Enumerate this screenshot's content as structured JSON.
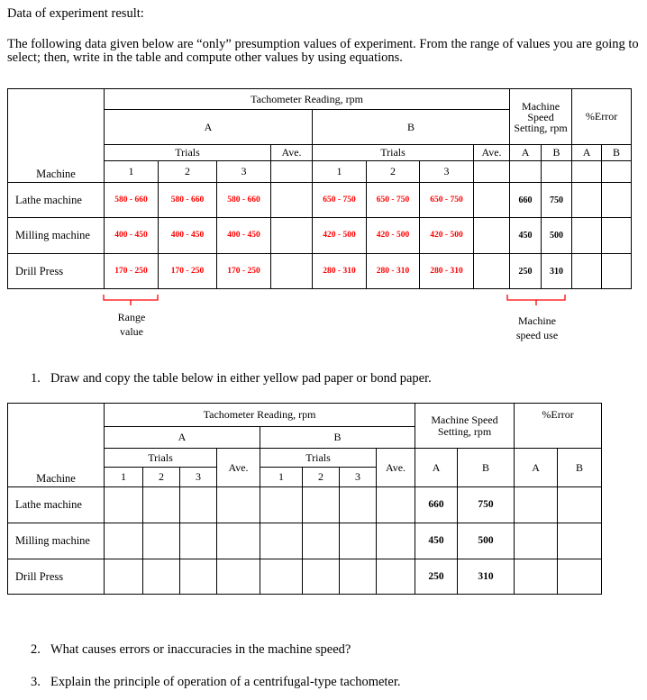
{
  "heading": "Data of experiment result:",
  "intro": "The following data given below are “only” presumption values of experiment. From the range of values you are going to select; then, write in the table and compute other values by using equations.",
  "table1": {
    "tachometer_header": "Tachometer Reading, rpm",
    "group_a": "A",
    "group_b": "B",
    "machine_speed_header": "Machine Speed Setting, rpm",
    "error_header": "%Error",
    "trials_label": "Trials",
    "ave_label": "Ave.",
    "machine_label": "Machine",
    "trial_numbers": [
      "1",
      "2",
      "3"
    ],
    "sub_a": "A",
    "sub_b": "B",
    "rows": [
      {
        "machine": "Lathe machine",
        "a_trials": [
          "580 - 660",
          "580 - 660",
          "580 - 660"
        ],
        "a_ave": "",
        "b_trials": [
          "650 - 750",
          "650 - 750",
          "650 - 750"
        ],
        "b_ave": "",
        "speed_a": "660",
        "speed_b": "750",
        "error_a": "",
        "error_b": ""
      },
      {
        "machine": "Milling machine",
        "a_trials": [
          "400 - 450",
          "400 - 450",
          "400 - 450"
        ],
        "a_ave": "",
        "b_trials": [
          "420 - 500",
          "420 - 500",
          "420 - 500"
        ],
        "b_ave": "",
        "speed_a": "450",
        "speed_b": "500",
        "error_a": "",
        "error_b": ""
      },
      {
        "machine": "Drill Press",
        "a_trials": [
          "170 - 250",
          "170 - 250",
          "170 - 250"
        ],
        "a_ave": "",
        "b_trials": [
          "280 - 310",
          "280 - 310",
          "280 - 310"
        ],
        "b_ave": "",
        "speed_a": "250",
        "speed_b": "310",
        "error_a": "",
        "error_b": ""
      }
    ],
    "accent_color": "#ff0000"
  },
  "annotations": {
    "range_value_line1": "Range",
    "range_value_line2": "value",
    "machine_speed_use_line1": "Machine",
    "machine_speed_use_line2": "speed use"
  },
  "questions": [
    {
      "number": "1.",
      "text": "Draw and copy the table below in either yellow pad paper or bond paper."
    },
    {
      "number": "2.",
      "text": "What causes errors or inaccuracies in the machine speed?"
    },
    {
      "number": "3.",
      "text": "Explain the principle of operation of a centrifugal-type tachometer."
    }
  ],
  "table2": {
    "tachometer_header": "Tachometer Reading, rpm",
    "group_a": "A",
    "group_b": "B",
    "machine_speed_header": "Machine Speed Setting, rpm",
    "error_header": "%Error",
    "trials_label": "Trials",
    "ave_label": "Ave.",
    "machine_label": "Machine",
    "trial_numbers": [
      "1",
      "2",
      "3"
    ],
    "sub_a": "A",
    "sub_b": "B",
    "rows": [
      {
        "machine": "Lathe machine",
        "speed_a": "660",
        "speed_b": "750"
      },
      {
        "machine": "Milling machine",
        "speed_a": "450",
        "speed_b": "500"
      },
      {
        "machine": "Drill Press",
        "speed_a": "250",
        "speed_b": "310"
      }
    ]
  }
}
